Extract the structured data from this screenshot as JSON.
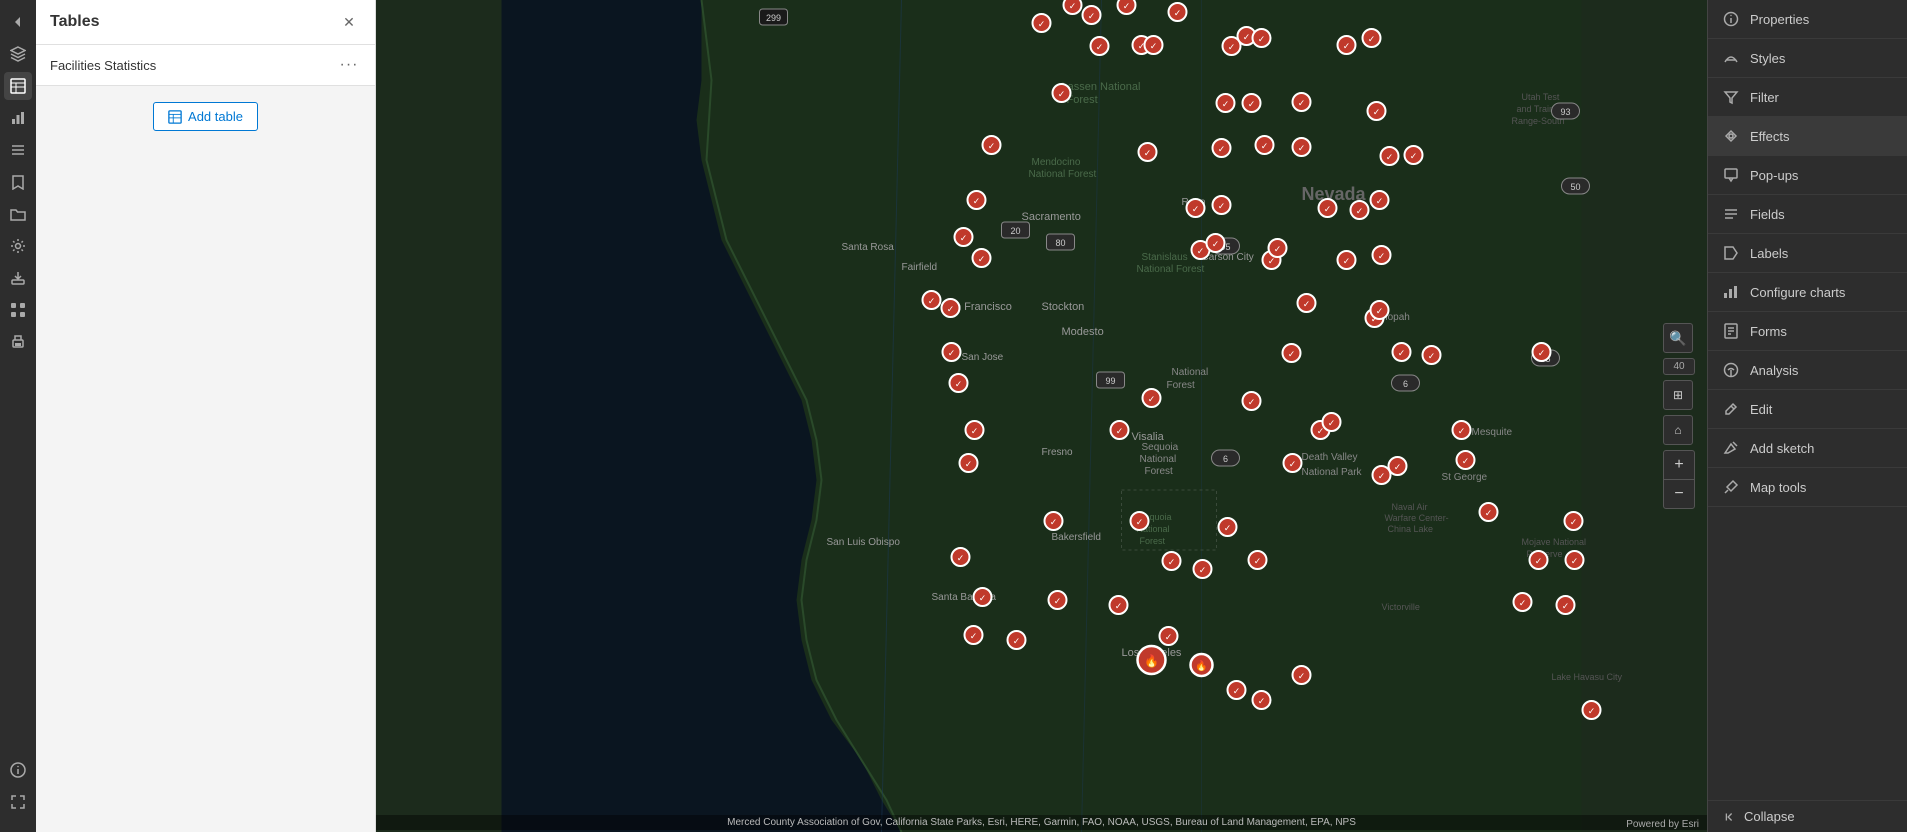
{
  "app": {
    "title": "Tables"
  },
  "tables_panel": {
    "title": "Tables",
    "subtitle": "Facilities Statistics",
    "add_table_label": "Add table",
    "dots": "···"
  },
  "right_panel": {
    "items": [
      {
        "id": "properties",
        "label": "Properties",
        "icon": "info"
      },
      {
        "id": "styles",
        "label": "Styles",
        "icon": "style"
      },
      {
        "id": "filter",
        "label": "Filter",
        "icon": "filter"
      },
      {
        "id": "effects",
        "label": "Effects",
        "icon": "effects"
      },
      {
        "id": "pop-ups",
        "label": "Pop-ups",
        "icon": "popup"
      },
      {
        "id": "fields",
        "label": "Fields",
        "icon": "fields"
      },
      {
        "id": "labels",
        "label": "Labels",
        "icon": "label"
      },
      {
        "id": "configure-charts",
        "label": "Configure charts",
        "icon": "chart"
      },
      {
        "id": "forms",
        "label": "Forms",
        "icon": "form"
      },
      {
        "id": "analysis",
        "label": "Analysis",
        "icon": "analysis"
      },
      {
        "id": "edit",
        "label": "Edit",
        "icon": "edit"
      },
      {
        "id": "add-sketch",
        "label": "Add sketch",
        "icon": "sketch"
      },
      {
        "id": "map-tools",
        "label": "Map tools",
        "icon": "tools"
      }
    ],
    "collapse_label": "Collapse"
  },
  "map": {
    "attribution": "Merced County Association of Gov, California State Parks, Esri, HERE, Garmin, FAO, NOAA, USGS, Bureau of Land Management, EPA, NPS",
    "zoom_level": "40",
    "powered_by": "Powered by Esri"
  },
  "markers": [
    {
      "x": 52,
      "y": 3
    },
    {
      "x": 28,
      "y": 8
    },
    {
      "x": 31,
      "y": 2
    },
    {
      "x": 25,
      "y": 14
    },
    {
      "x": 38,
      "y": 12
    },
    {
      "x": 44,
      "y": 22
    },
    {
      "x": 33,
      "y": 25
    },
    {
      "x": 18,
      "y": 25
    },
    {
      "x": 36,
      "y": 38
    },
    {
      "x": 22,
      "y": 38
    },
    {
      "x": 30,
      "y": 42
    },
    {
      "x": 39,
      "y": 45
    },
    {
      "x": 48,
      "y": 48
    },
    {
      "x": 35,
      "y": 55
    },
    {
      "x": 29,
      "y": 60
    },
    {
      "x": 20,
      "y": 65
    },
    {
      "x": 38,
      "y": 68
    },
    {
      "x": 44,
      "y": 72
    },
    {
      "x": 50,
      "y": 75
    },
    {
      "x": 55,
      "y": 78
    }
  ]
}
